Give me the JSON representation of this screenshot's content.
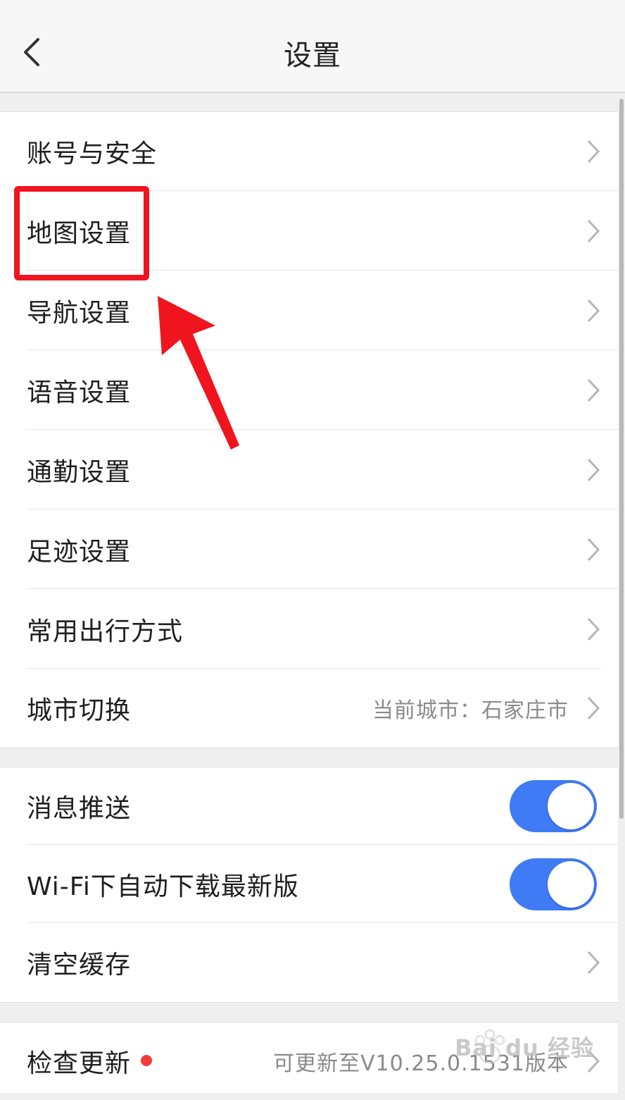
{
  "header": {
    "title": "设置"
  },
  "group1": {
    "items": [
      {
        "label": "账号与安全"
      },
      {
        "label": "地图设置"
      },
      {
        "label": "导航设置"
      },
      {
        "label": "语音设置"
      },
      {
        "label": "通勤设置"
      },
      {
        "label": "足迹设置"
      },
      {
        "label": "常用出行方式"
      },
      {
        "label": "城市切换",
        "value": "当前城市：石家庄市"
      }
    ]
  },
  "group2": {
    "items": [
      {
        "label": "消息推送",
        "toggle": "on"
      },
      {
        "label": "Wi-Fi下自动下载最新版",
        "toggle": "on"
      },
      {
        "label": "清空缓存"
      }
    ]
  },
  "group3": {
    "items": [
      {
        "label": "检查更新",
        "value": "可更新至V10.25.0.1531版本"
      }
    ]
  },
  "colors": {
    "toggle_on": "#3f7bf4",
    "highlight": "#f0141e",
    "badge": "#f23b3b"
  },
  "watermark": {
    "text": "Bai du 经验"
  }
}
